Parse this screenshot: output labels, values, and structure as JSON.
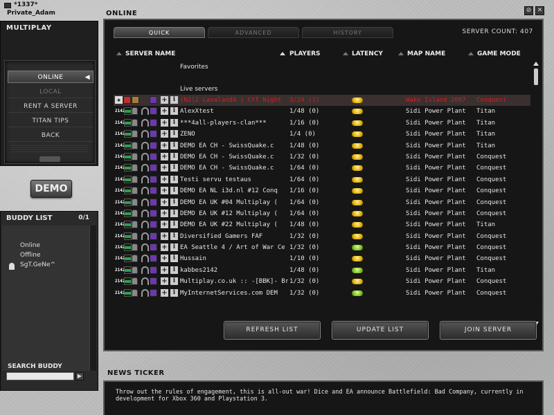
{
  "user": {
    "tag": "*1337*",
    "name": "Private_Adam"
  },
  "window": {
    "minimize_label": "⊘",
    "close_label": "✕"
  },
  "multiplay": {
    "title": "MULTIPLAY",
    "items": [
      {
        "label": "ONLINE",
        "state": "selected"
      },
      {
        "label": "LOCAL",
        "state": "disabled"
      },
      {
        "label": "RENT A SERVER",
        "state": "normal"
      },
      {
        "label": "TITAN TIPS",
        "state": "normal"
      },
      {
        "label": "BACK",
        "state": "normal"
      }
    ]
  },
  "demo": {
    "label": "DEMO"
  },
  "buddy": {
    "title": "BUDDY LIST",
    "count": "0/1",
    "groups": [
      "Online",
      "Offline"
    ],
    "buddies": [
      "SgT.GeNe^"
    ],
    "search_label": "SEARCH BUDDY",
    "search_value": ""
  },
  "online": {
    "title": "ONLINE"
  },
  "tabs": [
    {
      "label": "QUICK",
      "active": true
    },
    {
      "label": "ADVANCED",
      "active": false
    },
    {
      "label": "HISTORY",
      "active": false
    }
  ],
  "server_count": "SERVER COUNT: 407",
  "columns": {
    "server_name": "SERVER NAME",
    "players": "PLAYERS",
    "latency": "LATENCY",
    "map_name": "MAP NAME",
    "game_mode": "GAME MODE"
  },
  "sections": {
    "favorites": "Favorites",
    "live": "Live servers"
  },
  "servers": [
    {
      "name": "(N2)2 Lavaland4 | Ctf Night",
      "players": "3/24 (1)",
      "latency": "yellow",
      "map": "Wake Island 2007",
      "mode": "Conquest",
      "highlight": true
    },
    {
      "name": "AlexXtest",
      "players": "1/48 (0)",
      "latency": "yellow",
      "map": "Sidi Power Plant",
      "mode": "Titan"
    },
    {
      "name": "***4all-players-clan***",
      "players": "1/16 (0)",
      "latency": "yellow",
      "map": "Sidi Power Plant",
      "mode": "Titan"
    },
    {
      "name": "ZENO",
      "players": "1/4  (0)",
      "latency": "yellow",
      "map": "Sidi Power Plant",
      "mode": "Titan"
    },
    {
      "name": "DEMO EA CH - SwissQuake.c",
      "players": "1/48 (0)",
      "latency": "yellow",
      "map": "Sidi Power Plant",
      "mode": "Titan"
    },
    {
      "name": "DEMO EA CH - SwissQuake.c",
      "players": "1/32 (0)",
      "latency": "yellow",
      "map": "Sidi Power Plant",
      "mode": "Conquest"
    },
    {
      "name": "DEMO EA CH - SwissQuake.c",
      "players": "1/64 (0)",
      "latency": "yellow",
      "map": "Sidi Power Plant",
      "mode": "Conquest"
    },
    {
      "name": "Testi servu testaus",
      "players": "1/64 (0)",
      "latency": "yellow",
      "map": "Sidi Power Plant",
      "mode": "Conquest"
    },
    {
      "name": "DEMO EA NL i3d.nl #12 Conq",
      "players": "1/16 (0)",
      "latency": "yellow",
      "map": "Sidi Power Plant",
      "mode": "Conquest"
    },
    {
      "name": "DEMO EA UK #04 Multiplay (",
      "players": "1/64 (0)",
      "latency": "yellow",
      "map": "Sidi Power Plant",
      "mode": "Conquest"
    },
    {
      "name": "DEMO EA UK #12 Multiplay (",
      "players": "1/64 (0)",
      "latency": "yellow",
      "map": "Sidi Power Plant",
      "mode": "Conquest"
    },
    {
      "name": "DEMO EA UK #22 Multiplay (",
      "players": "1/48 (0)",
      "latency": "yellow",
      "map": "Sidi Power Plant",
      "mode": "Titan"
    },
    {
      "name": "Diversified Gamers FAF",
      "players": "1/32 (0)",
      "latency": "yellow",
      "map": "Sidi Power Plant",
      "mode": "Conquest"
    },
    {
      "name": "EA Seattle 4 / Art of War Ce",
      "players": "1/32 (0)",
      "latency": "green",
      "map": "Sidi Power Plant",
      "mode": "Conquest"
    },
    {
      "name": "Hussain",
      "players": "1/10 (0)",
      "latency": "yellow",
      "map": "Sidi Power Plant",
      "mode": "Conquest"
    },
    {
      "name": "kabbes2142",
      "players": "1/48 (0)",
      "latency": "green",
      "map": "Sidi Power Plant",
      "mode": "Titan"
    },
    {
      "name": "Multiplay.co.uk :: -[BBK]- Brit",
      "players": "1/32 (0)",
      "latency": "yellow",
      "map": "Sidi Power Plant",
      "mode": "Conquest"
    },
    {
      "name": "MyInternetServices.com DEM",
      "players": "1/32 (0)",
      "latency": "green",
      "map": "Sidi Power Plant",
      "mode": "Conquest"
    }
  ],
  "buttons": {
    "refresh": "REFRESH LIST",
    "update": "UPDATE LIST",
    "join": "JOIN SERVER"
  },
  "news": {
    "title": "NEWS TICKER",
    "text": "Throw out the rules of engagement, this is all-out war! Dice and EA announce Battlefield: Bad Company, currently in development for Xbox 360 and Playstation 3."
  },
  "colors": {
    "highlight_row": "#d02020",
    "latency_yellow": "#e0b000",
    "latency_green": "#7fc020"
  }
}
